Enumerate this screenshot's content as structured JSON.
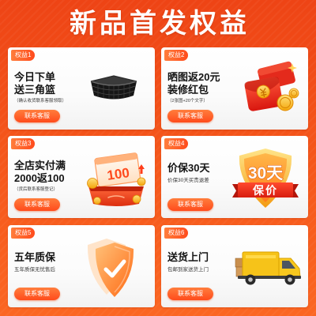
{
  "page": {
    "title": "新品首发权益"
  },
  "colors": {
    "background_top": "#ee4415",
    "background_bottom": "#fb6622",
    "accent": "#ff4b1c",
    "accent_light": "#ff7d3c",
    "card": "#ffffff",
    "title_text": "#141414",
    "subtitle_text": "#3a3a3a"
  },
  "benefits": [
    {
      "tag": "权益1",
      "title_lines": [
        "今日下单",
        "送三角篮"
      ],
      "subtitle": "（确认收货联系客服领取）",
      "button": "联系客服",
      "icon": "corner-basket-icon"
    },
    {
      "tag": "权益2",
      "title_lines": [
        "晒图返20元",
        "装修红包"
      ],
      "subtitle": "（2张图+20个文字）",
      "button": "联系客服",
      "icon": "red-envelope-icon"
    },
    {
      "tag": "权益3",
      "title_lines": [
        "全店实付满",
        "2000返100"
      ],
      "subtitle": "（货后联系客服登记）",
      "button": "联系客服",
      "icon": "voucher-icon",
      "icon_text": "100"
    },
    {
      "tag": "权益4",
      "title_lines": [
        "价保30天"
      ],
      "subtitle": "价保30天买贵退差",
      "button": "联系客服",
      "icon": "price-guarantee-badge-icon",
      "icon_lines": [
        "30天",
        "保价"
      ]
    },
    {
      "tag": "权益5",
      "title_lines": [
        "五年质保"
      ],
      "subtitle": "五年质保无忧售后",
      "button": "联系客服",
      "icon": "shield-check-icon"
    },
    {
      "tag": "权益6",
      "title_lines": [
        "送货上门"
      ],
      "subtitle": "包邮到家送货上门",
      "button": "联系客服",
      "icon": "delivery-truck-icon"
    }
  ]
}
